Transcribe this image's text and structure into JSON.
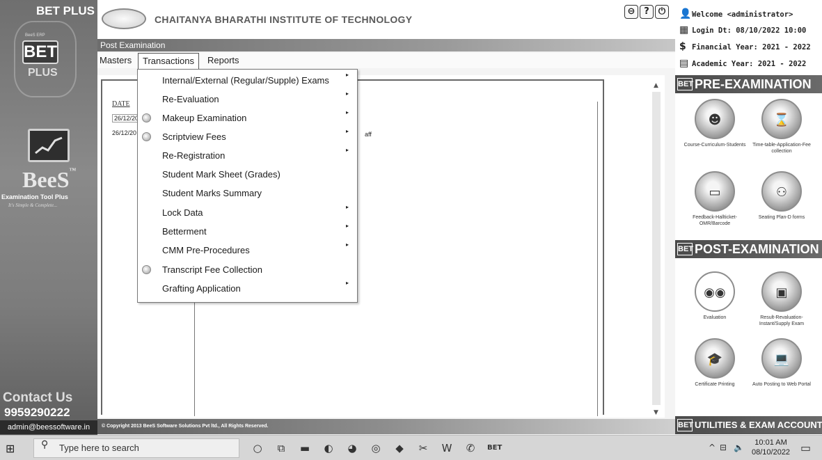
{
  "sidebar": {
    "product": "BET PLUS",
    "bet_small": "BeeS ERP",
    "bet": "BET",
    "plus": "PLUS",
    "brand": "BeeS",
    "brand_tm": "™",
    "tagline": "Examination Tool Plus",
    "slogan": "It's Simple & Complete...",
    "contact": "Contact Us",
    "phone": "9959290222",
    "email": "admin@beessoftware.in"
  },
  "header": {
    "title": "CHAITANYA BHARATHI INSTITUTE OF TECHNOLOGY",
    "btn_minimize": "⊖",
    "btn_help": "?",
    "btn_power": "⏻"
  },
  "section_title": "Post Examination",
  "menu": {
    "masters": "Masters",
    "transactions": "Transactions",
    "reports": "Reports"
  },
  "dropdown": [
    {
      "label": "Internal/External (Regular/Supple) Exams",
      "arrow": "▸"
    },
    {
      "label": "Re-Evaluation",
      "arrow": "▸"
    },
    {
      "label": "Makeup Examination",
      "arrow": "▸"
    },
    {
      "label": "Scriptview Fees",
      "arrow": "▸"
    },
    {
      "label": "Re-Registration",
      "arrow": "▸"
    },
    {
      "label": "Student Mark Sheet (Grades)",
      "arrow": ""
    },
    {
      "label": "Student Marks Summary",
      "arrow": ""
    },
    {
      "label": "Lock Data",
      "arrow": "▸"
    },
    {
      "label": "Betterment",
      "arrow": "▸"
    },
    {
      "label": "CMM Pre-Procedures",
      "arrow": "▸"
    },
    {
      "label": "Transcript Fee Collection",
      "arrow": ""
    },
    {
      "label": "Grafting Application",
      "arrow": "▸"
    }
  ],
  "content": {
    "date_header": "DATE",
    "rows": [
      "26/12/20",
      "26/12/20"
    ],
    "aff_text": "aff",
    "scroll_up": "▲",
    "scroll_down": "▼"
  },
  "footer": "© Copyright 2013 BeeS Software Solutions Pvt ltd., All Rights Reserved.",
  "right": {
    "welcome": "Welcome <administrator>",
    "login": "Login Dt: 08/10/2022 10:00",
    "financial_year": "Financial Year: 2021 - 2022",
    "academic_year": "Academic Year: 2021 - 2022",
    "pre_exam": "PRE-EXAMINATION",
    "post_exam": "POST-EXAMINATION",
    "utilities": "UTILITIES & EXAM ACCOUNTS",
    "bet_badge": "BET",
    "tiles_pre": [
      "Course-Curriculum-Students",
      "Time-table-Application-Fee collection",
      "Feedback-Hallticket-OMR/Barcode",
      "Seating Plan-D forms"
    ],
    "tiles_post": [
      "Evaluation",
      "Result-Revaluation-Instant/Supply Exam",
      "Certificate Printing",
      "Auto Posting to Web Portal"
    ]
  },
  "taskbar": {
    "search_placeholder": "Type here to search",
    "time": "10:01 AM",
    "date": "08/10/2022"
  }
}
